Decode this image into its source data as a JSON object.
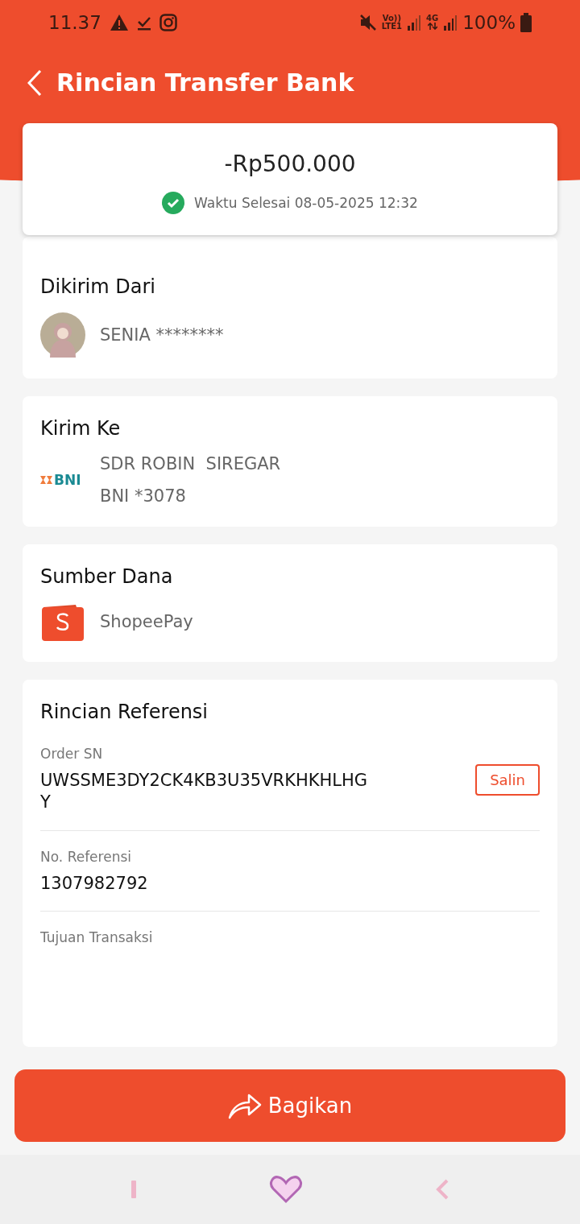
{
  "status_bar": {
    "time": "11.37",
    "volte": "Vo))",
    "lte": "LTE1",
    "network": "4G",
    "battery": "100%"
  },
  "header": {
    "title": "Rincian Transfer Bank"
  },
  "summary": {
    "amount": "-Rp500.000",
    "status": "Waktu Selesai 08-05-2025 12:32"
  },
  "sender": {
    "heading": "Dikirim Dari",
    "name": "SENIA ********"
  },
  "recipient": {
    "heading": "Kirim Ke",
    "bank_logo": "BNI",
    "name": "SDR ROBIN  SIREGAR",
    "account": "BNI *3078"
  },
  "source": {
    "heading": "Sumber Dana",
    "method": "ShopeePay"
  },
  "reference": {
    "heading": "Rincian Referensi",
    "fields": [
      {
        "label": "Order SN",
        "value": "UWSSME3DY2CK4KB3U35VRKHKHLHGY",
        "copy": "Salin"
      },
      {
        "label": "No. Referensi",
        "value": "1307982792"
      },
      {
        "label": "Tujuan Transaksi"
      }
    ]
  },
  "share_button": {
    "label": "Bagikan"
  }
}
